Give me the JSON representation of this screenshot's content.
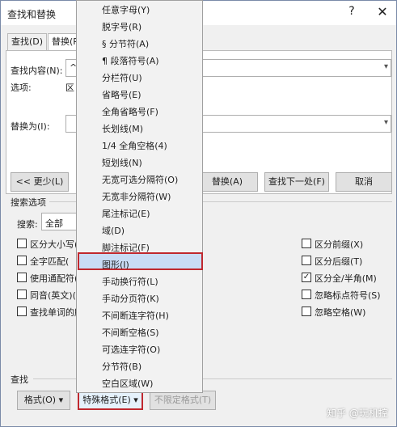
{
  "window": {
    "title": "查找和替换",
    "help": "?",
    "close": "✕"
  },
  "tabs": {
    "find": "查找(D)",
    "replace": "替换(P"
  },
  "find": {
    "label": "查找内容(N):",
    "value": "^",
    "options_label": "选项:",
    "options_value": "区"
  },
  "replace": {
    "label": "替换为(I):"
  },
  "buttons": {
    "less": "<< 更少(L)",
    "replace_all": "替换(A)",
    "find_next": "查找下一处(F)",
    "cancel": "取消"
  },
  "search_options": {
    "title": "搜索选项",
    "search_label": "搜索:",
    "search_value": "全部"
  },
  "left_checks": [
    {
      "label": "区分大小写(",
      "checked": false
    },
    {
      "label": "全字匹配(",
      "checked": false
    },
    {
      "label": "使用通配符(",
      "checked": false
    },
    {
      "label": "同音(英文)(",
      "checked": false
    },
    {
      "label": "查找单词的所",
      "checked": false
    }
  ],
  "right_checks": [
    {
      "label": "区分前缀(X)",
      "checked": false
    },
    {
      "label": "区分后缀(T)",
      "checked": false
    },
    {
      "label": "区分全/半角(M)",
      "checked": true
    },
    {
      "label": "忽略标点符号(S)",
      "checked": false
    },
    {
      "label": "忽略空格(W)",
      "checked": false
    }
  ],
  "bottom": {
    "section": "查找",
    "format": "格式(O) ▾",
    "special": "特殊格式(E) ▾",
    "no_format": "不限定格式(T)"
  },
  "menu": [
    "任意字母(Y)",
    "脱字号(R)",
    "§ 分节符(A)",
    "¶ 段落符号(A)",
    "分栏符(U)",
    "省略号(E)",
    "全角省略号(F)",
    "长划线(M)",
    "1/4 全角空格(4)",
    "短划线(N)",
    "无宽可选分隔符(O)",
    "无宽非分隔符(W)",
    "尾注标记(E)",
    "域(D)",
    "脚注标记(F)",
    "图形(I)",
    "手动换行符(L)",
    "手动分页符(K)",
    "不间断连字符(H)",
    "不间断空格(S)",
    "可选连字符(O)",
    "分节符(B)",
    "空白区域(W)"
  ],
  "watermark": "知乎 @玩机控"
}
